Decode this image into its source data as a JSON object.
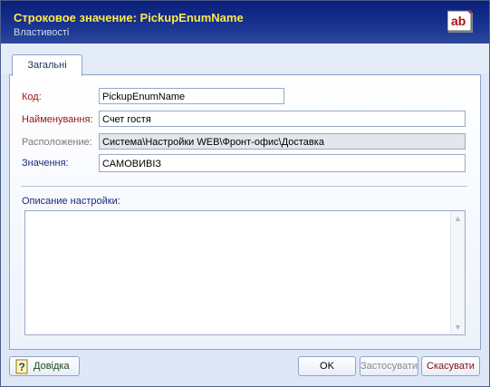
{
  "header": {
    "title": "Строковое значение:  PickupEnumName",
    "subtitle": "Властивості",
    "icon": "ab-icon",
    "icon_text": "ab"
  },
  "tabs": [
    {
      "label": "Загальні",
      "active": true
    }
  ],
  "form": {
    "code": {
      "label": "Код:",
      "value": "PickupEnumName"
    },
    "name": {
      "label": "Найменування:",
      "value": "Счет гостя"
    },
    "location": {
      "label": "Расположение:",
      "value": "Система\\Настройки WEB\\Фронт-офис\\Доставка"
    },
    "value": {
      "label": "Значення:",
      "value": "САМОВИВІЗ"
    },
    "description": {
      "label": "Описание настройки:",
      "value": ""
    }
  },
  "footer": {
    "help_label": "Довідка",
    "ok_label": "OK",
    "apply_label": "Застосувати",
    "cancel_label": "Скасувати"
  },
  "colors": {
    "header_bg": "#17338f",
    "title": "#ffe84a",
    "required_label": "#9a1616",
    "readonly_label": "#7a7a7a"
  }
}
